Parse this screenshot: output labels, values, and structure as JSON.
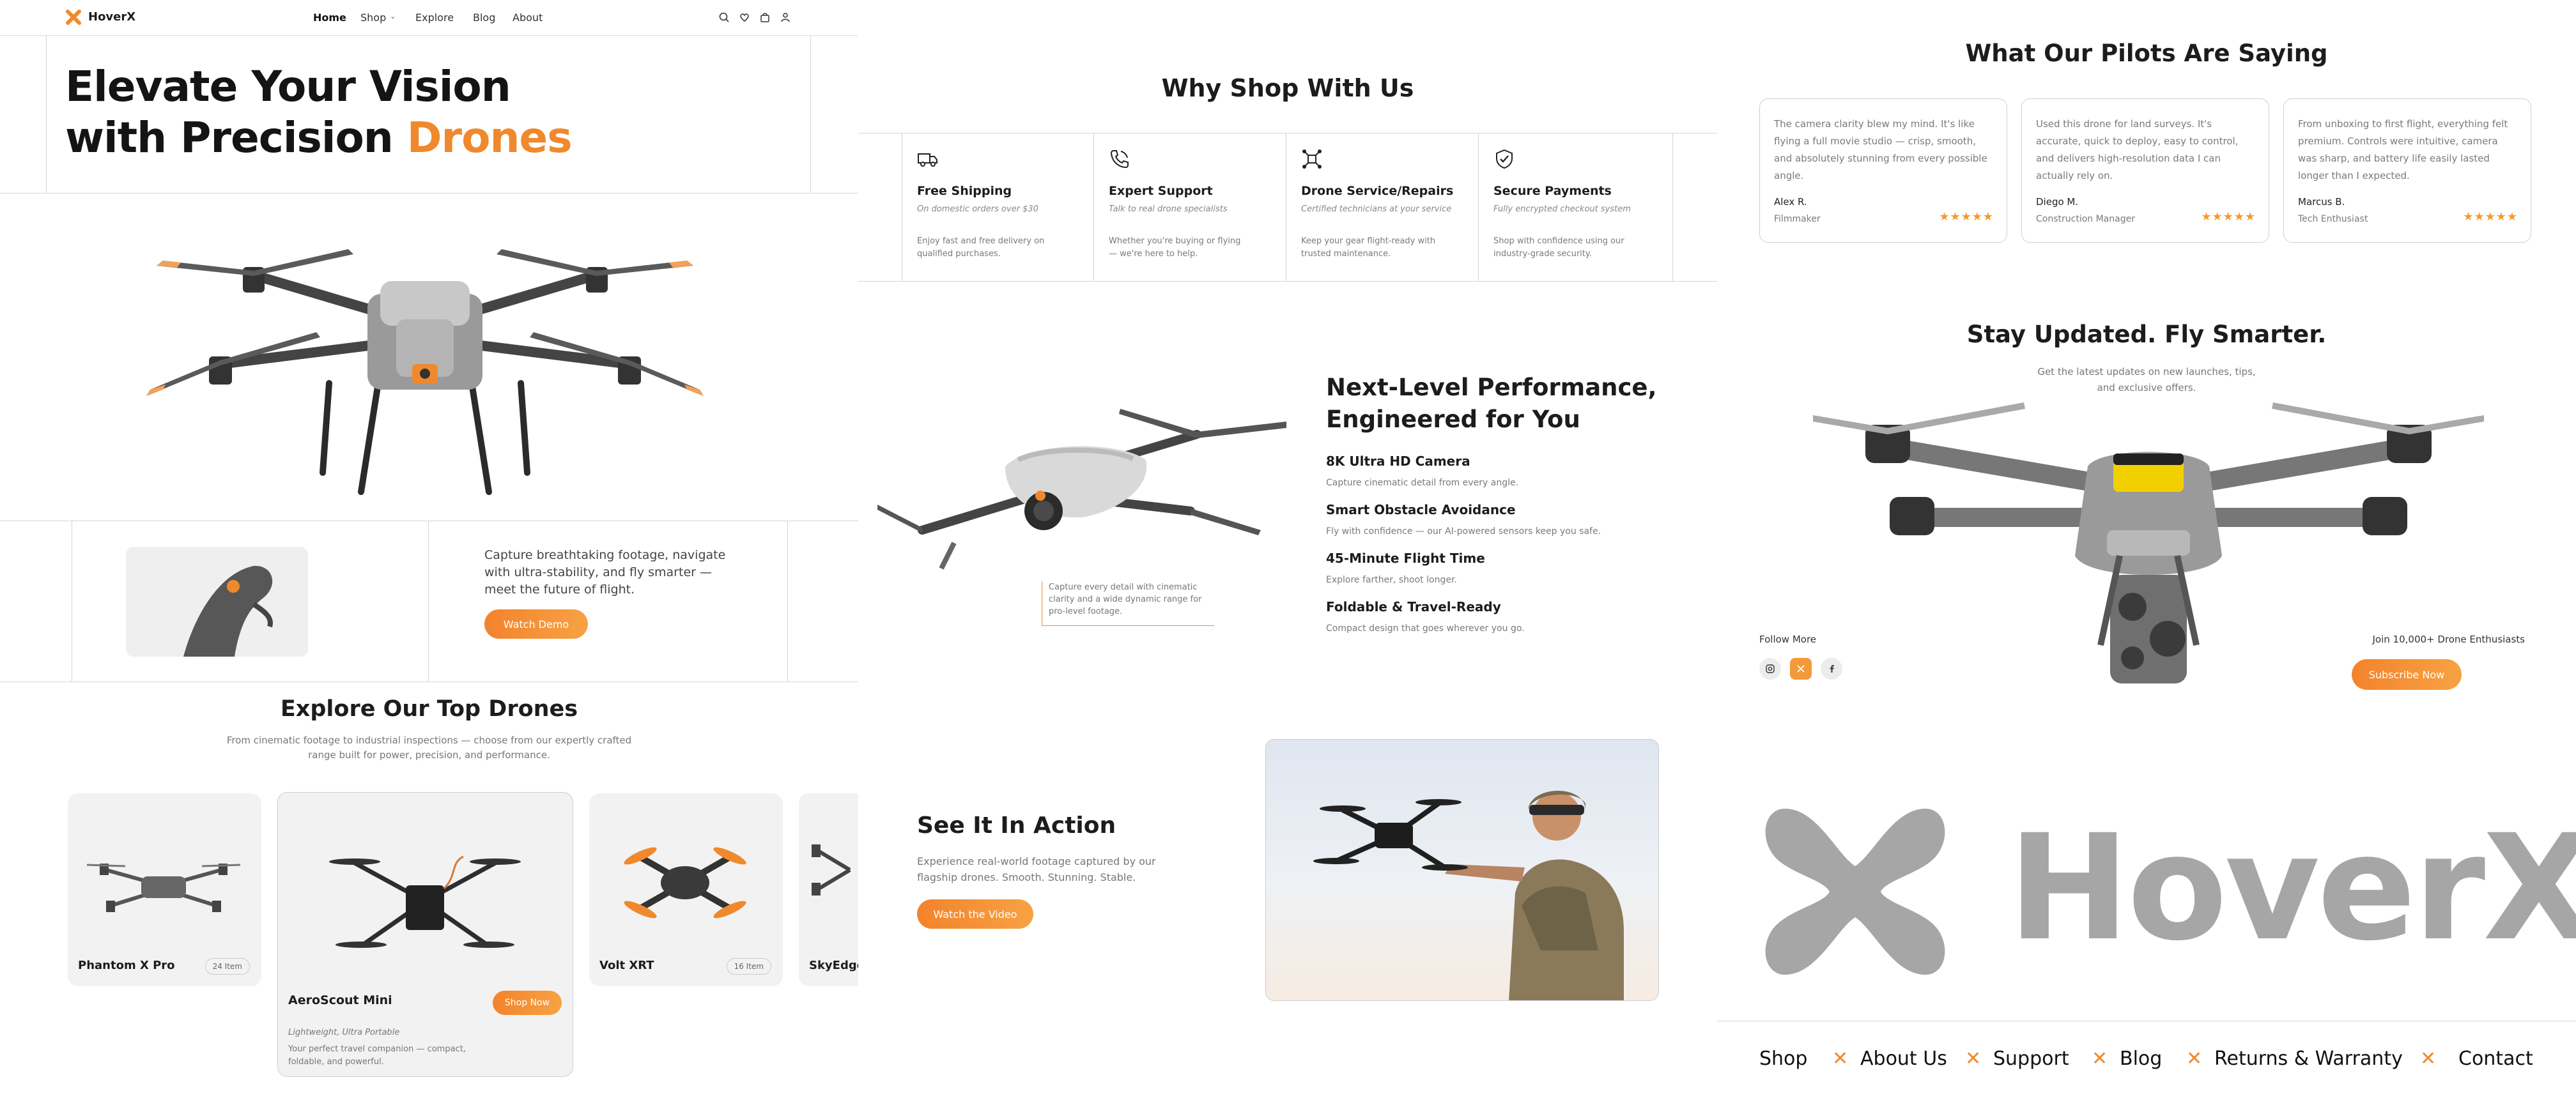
{
  "brand": {
    "name": "HoverX",
    "accent": "#f0892d"
  },
  "nav": {
    "items": [
      "Home",
      "Shop",
      "Explore",
      "Blog",
      "About"
    ]
  },
  "hero": {
    "title_line1": "Elevate Your Vision",
    "title_line2_prefix": "with Precision ",
    "title_line2_accent": "Drones",
    "tagline": "Capture breathtaking footage, navigate with ultra-stability, and fly smarter — meet the future of flight.",
    "cta": "Watch Demo"
  },
  "top_drones": {
    "title": "Explore Our Top Drones",
    "subtitle_line1": "From cinematic footage to industrial inspections — choose from our expertly crafted",
    "subtitle_line2": "range built for power, precision, and performance.",
    "cards": [
      {
        "name": "Phantom X Pro",
        "count": "24 Item"
      },
      {
        "name": "AeroScout Mini",
        "cta": "Shop Now",
        "tag": "Lightweight, Ultra Portable",
        "desc_line1": "Your perfect travel companion — compact,",
        "desc_line2": "foldable, and powerful."
      },
      {
        "name": "Volt XRT",
        "count": "16 Item"
      },
      {
        "name": "SkyEdge"
      }
    ]
  },
  "why": {
    "title": "Why Shop With Us",
    "features": [
      {
        "icon": "truck-icon",
        "title": "Free Shipping",
        "sub": "On domestic orders over $30",
        "desc": "Enjoy fast and free delivery on qualified purchases."
      },
      {
        "icon": "phone-icon",
        "title": "Expert Support",
        "sub": "Talk to real drone specialists",
        "desc": "Whether you're buying or flying — we're here to help."
      },
      {
        "icon": "drone-service-icon",
        "title": "Drone Service/Repairs",
        "sub": "Certified technicians at your service",
        "desc": "Keep your gear flight-ready with trusted maintenance."
      },
      {
        "icon": "shield-check-icon",
        "title": "Secure Payments",
        "sub": "Fully encrypted checkout system",
        "desc": "Shop with confidence using our industry-grade security."
      }
    ]
  },
  "performance": {
    "title_line1": "Next-Level Performance,",
    "title_line2": "Engineered for You",
    "caption": "Capture every detail with cinematic clarity and a wide dynamic range for pro-level footage.",
    "specs": [
      {
        "title": "8K Ultra HD Camera",
        "desc": "Capture cinematic detail from every angle."
      },
      {
        "title": "Smart Obstacle Avoidance",
        "desc": "Fly with confidence — our AI-powered sensors keep you safe."
      },
      {
        "title": "45-Minute Flight Time",
        "desc": "Explore farther, shoot longer."
      },
      {
        "title": "Foldable & Travel-Ready",
        "desc": "Compact design that goes wherever you go."
      }
    ]
  },
  "action": {
    "title": "See It In Action",
    "desc_line1": "Experience real-world footage captured by our",
    "desc_line2": "flagship drones. Smooth. Stunning. Stable.",
    "cta": "Watch the Video"
  },
  "testimonials": {
    "title": "What Our Pilots Are Saying",
    "items": [
      {
        "quote": "The camera clarity blew my mind. It's like flying a full movie studio — crisp, smooth, and absolutely stunning from every possible angle.",
        "name": "Alex R.",
        "role": "Filmmaker",
        "stars": "★★★★★"
      },
      {
        "quote": "Used this drone for land surveys. It's accurate, quick to deploy, easy to control, and delivers high-resolution data I can actually rely on.",
        "name": "Diego M.",
        "role": "Construction Manager",
        "stars": "★★★★★"
      },
      {
        "quote": "From unboxing to first flight, everything felt premium. Controls were intuitive, camera was sharp, and battery life easily lasted longer than I expected.",
        "name": "Marcus B.",
        "role": "Tech Enthusiast",
        "stars": "★★★★★"
      }
    ]
  },
  "newsletter": {
    "title": "Stay Updated. Fly Smarter.",
    "sub_line1": "Get the latest updates on new launches, tips,",
    "sub_line2": "and exclusive offers.",
    "follow": "Follow More",
    "join": "Join 10,000+ Drone Enthusiasts",
    "cta": "Subscribe Now"
  },
  "footer": {
    "links": [
      "Shop",
      "About Us",
      "Support",
      "Blog",
      "Returns & Warranty",
      "Contact"
    ]
  }
}
